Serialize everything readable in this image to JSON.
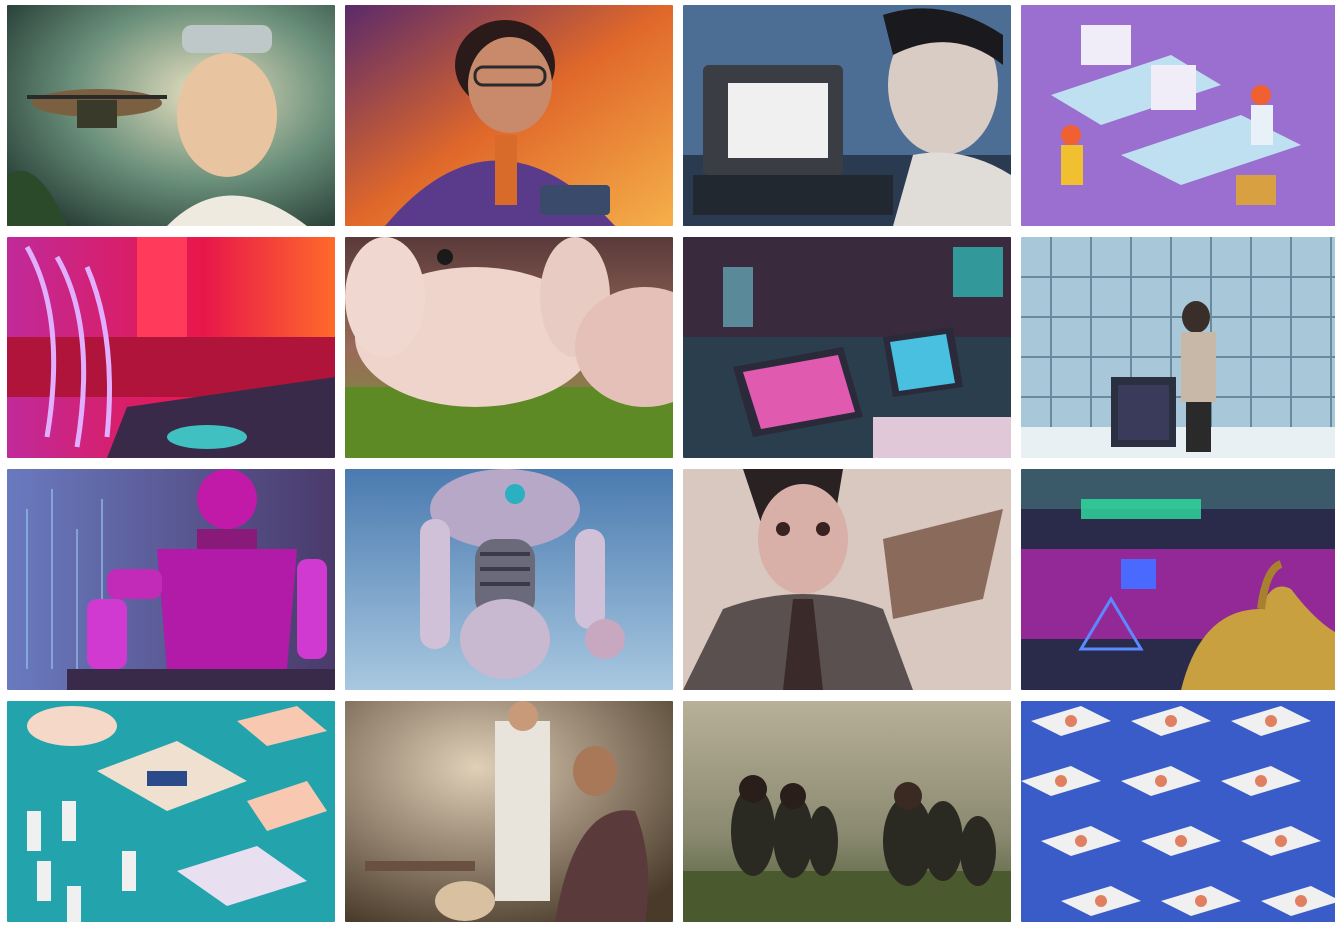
{
  "gallery": {
    "tiles": [
      {
        "subject": "boy-with-goggles-and-drone",
        "palette": [
          "#1f3a36",
          "#e8c9a8",
          "#6a8f7a"
        ]
      },
      {
        "subject": "boy-with-glasses-tinkering-electronics",
        "palette": [
          "#e0682a",
          "#5a2a6a",
          "#f5b04a"
        ]
      },
      {
        "subject": "woman-at-retro-computer",
        "palette": [
          "#4c6e94",
          "#d8d2cc",
          "#2a2f38"
        ]
      },
      {
        "subject": "isometric-people-at-desks",
        "palette": [
          "#9a6fd0",
          "#f0f0f8",
          "#f06030"
        ]
      },
      {
        "subject": "neon-laptop-red-room",
        "palette": [
          "#e8174a",
          "#c02a9a",
          "#ff6a2a"
        ]
      },
      {
        "subject": "fluffy-bunnies-on-grass",
        "palette": [
          "#eac7bf",
          "#6e9a2e",
          "#7a4a4a"
        ]
      },
      {
        "subject": "cyberpunk-tablets-lab",
        "palette": [
          "#2a4a5a",
          "#e0a0c0",
          "#30c8c0"
        ]
      },
      {
        "subject": "man-in-server-room",
        "palette": [
          "#a8c8da",
          "#2a3440",
          "#e8f4f8"
        ]
      },
      {
        "subject": "pink-robot-at-table",
        "palette": [
          "#b21aa8",
          "#3a4a7a",
          "#e84ae0"
        ]
      },
      {
        "subject": "humanoid-robot-sky",
        "palette": [
          "#6f9fc8",
          "#b8a8c8",
          "#2ab0c0"
        ]
      },
      {
        "subject": "painted-anime-girl",
        "palette": [
          "#d8c8c0",
          "#2a2222",
          "#8a6a5a"
        ]
      },
      {
        "subject": "neon-city-creature",
        "palette": [
          "#c02ab8",
          "#2a2a4a",
          "#c8a040"
        ]
      },
      {
        "subject": "isometric-lab-with-animals",
        "palette": [
          "#23a3ac",
          "#f5d8c8",
          "#f0f0f0"
        ]
      },
      {
        "subject": "woman-and-scientist-workshop",
        "palette": [
          "#8a7058",
          "#e0d0b8",
          "#4a3a2a"
        ]
      },
      {
        "subject": "girls-in-grass-field",
        "palette": [
          "#7a8068",
          "#2a2a22",
          "#b8b098"
        ]
      },
      {
        "subject": "isometric-grid-trays",
        "palette": [
          "#3a5cc8",
          "#f0f0f0",
          "#e08060"
        ]
      }
    ]
  }
}
